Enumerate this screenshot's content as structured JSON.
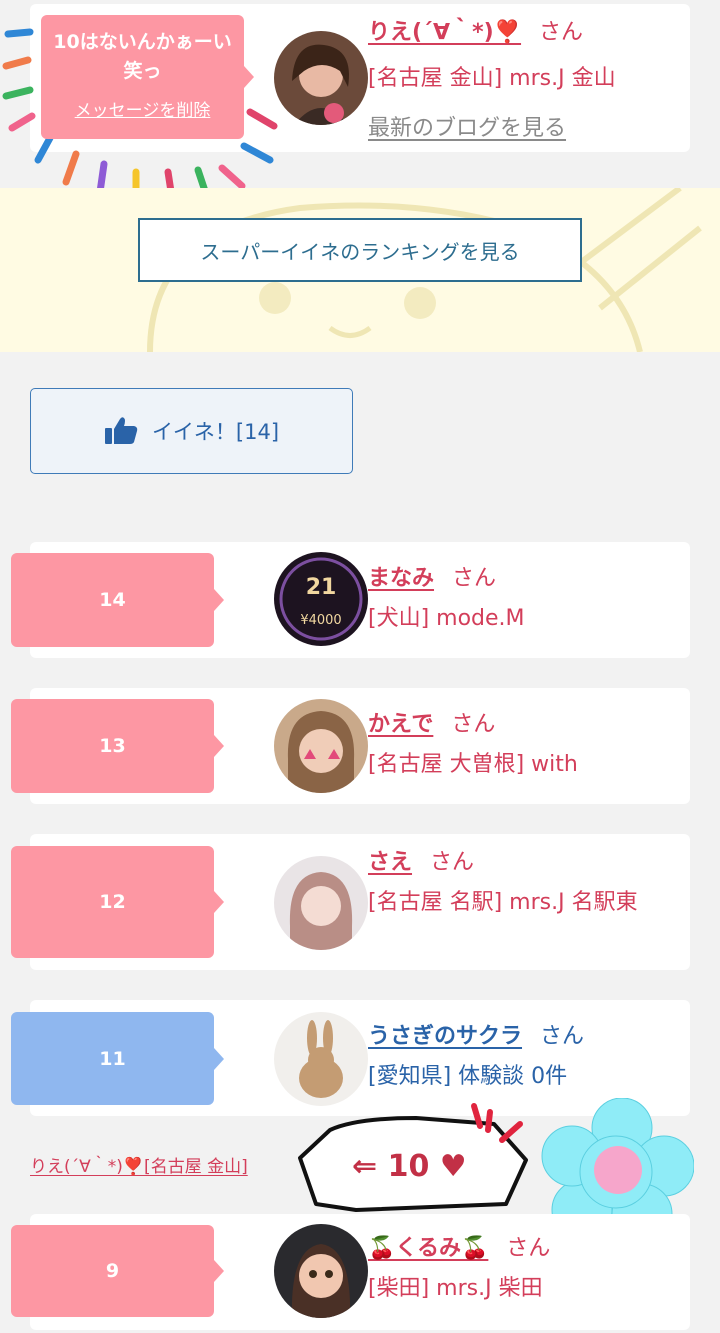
{
  "top_entry": {
    "message": "10はないんかぁーい笑っ",
    "delete_label": "メッセージを削除",
    "name": "りえ(´∀｀*)❣️",
    "honorific": "さん",
    "shop": "[名古屋 金山] mrs.J 金山",
    "blog_link": "最新のブログを見る"
  },
  "ranking_button_label": "スーパーイイネのランキングを見る",
  "iine_button": {
    "label": "イイネ！[14]",
    "icon": "thumbs-up-icon"
  },
  "entries": [
    {
      "number": "14",
      "name": "まなみ",
      "honorific": "さん",
      "shop": "[犬山] mode.M",
      "bubble_color": "#fd97a3"
    },
    {
      "number": "13",
      "name": "かえで",
      "honorific": "さん",
      "shop": "[名古屋 大曽根] with",
      "bubble_color": "#fd97a3"
    },
    {
      "number": "12",
      "name": "さえ",
      "honorific": "さん",
      "shop": "[名古屋 名駅] mrs.J 名駅東",
      "bubble_color": "#fd97a3"
    },
    {
      "number": "11",
      "name": "うさぎのサクラ",
      "honorific": "さん",
      "shop": "[愛知県] 体験談 0件",
      "bubble_color": "#8fb7ef"
    },
    {
      "number": "9",
      "name": "🍒くるみ🍒",
      "honorific": "さん",
      "shop": "[柴田] mrs.J 柴田",
      "bubble_color": "#fd97a3"
    }
  ],
  "message_line": "りえ(´∀｀*)❣️[名古屋 金山]",
  "sticker_text": "⇐ 10 ♥",
  "colors": {
    "pink": "#fd97a3",
    "blue": "#8fb7ef",
    "name_red": "#d33e5a",
    "name_blue": "#2a63a8"
  }
}
